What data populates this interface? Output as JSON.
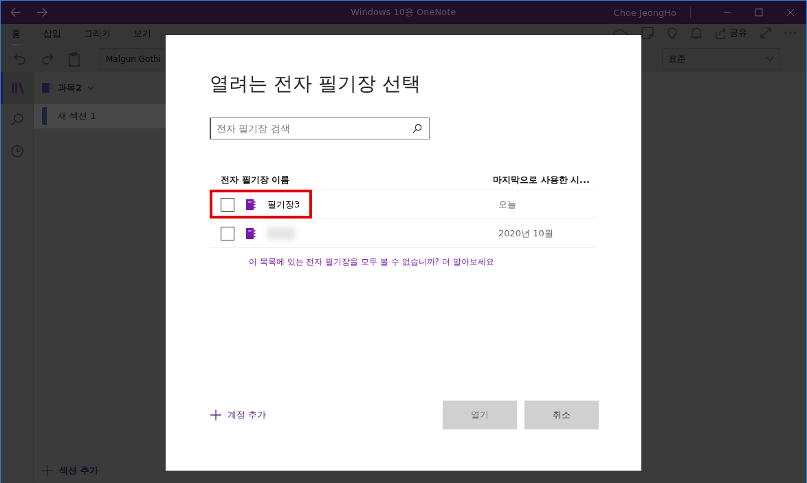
{
  "window": {
    "title": "Windows 10용 OneNote",
    "user": "Choe JeongHo"
  },
  "ribbon": {
    "tabs": [
      {
        "label": "홈",
        "selected": true
      },
      {
        "label": "삽입",
        "selected": false
      },
      {
        "label": "그리기",
        "selected": false
      },
      {
        "label": "보기",
        "selected": false
      }
    ],
    "share_label": "공유",
    "font_box": "Malgun Gothi",
    "style_box": "표준"
  },
  "nav": {
    "notebook": "과목2",
    "sections": [
      {
        "label": "새 섹션 1",
        "selected": true
      }
    ],
    "add_section": "섹션 추가"
  },
  "dialog": {
    "title": "열려는 전자 필기장 선택",
    "search": {
      "placeholder": "전자 필기장 검색"
    },
    "columns": [
      "전자 필기장 이름",
      "마지막으로 사용한 시..."
    ],
    "rows": [
      {
        "name": "필기장3",
        "date": "오늘",
        "checked": false,
        "redacted": false,
        "highlighted": true
      },
      {
        "date": "2020년 10월",
        "checked": false,
        "redacted": true,
        "highlighted": false
      }
    ],
    "help_text": "이 목록에 있는 전자 필기장을 모두 볼 수 없습니까? 더 알아보세요",
    "add_account": "계정 추가",
    "buttons": [
      {
        "label": "열기",
        "disabled": true
      },
      {
        "label": "취소",
        "disabled": false
      }
    ]
  }
}
